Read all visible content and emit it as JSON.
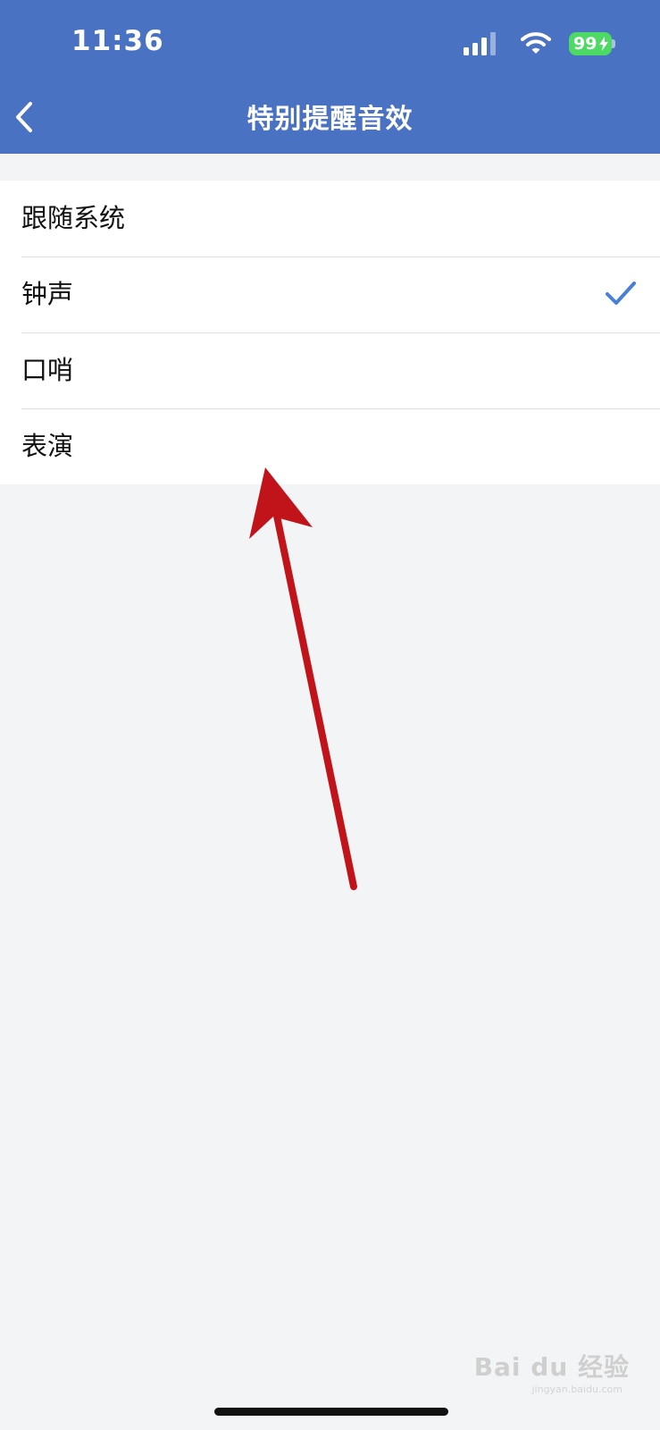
{
  "status_bar": {
    "time": "11:36",
    "battery_level": "99",
    "icons": [
      "signal-icon",
      "wifi-icon",
      "battery-charging-icon"
    ]
  },
  "header": {
    "title": "特别提醒音效",
    "back_icon": "chevron-left-icon",
    "background_color": "#4a72c2"
  },
  "options": [
    {
      "label": "跟随系统",
      "selected": false
    },
    {
      "label": "钟声",
      "selected": true
    },
    {
      "label": "口哨",
      "selected": false
    },
    {
      "label": "表演",
      "selected": false
    }
  ],
  "colors": {
    "accent": "#4a72c2",
    "check": "#4a7fd6",
    "annotation_arrow": "#c0141a",
    "background": "#f3f4f6"
  },
  "watermark": {
    "brand": "Bai du 经验",
    "url": "jingyan.baidu.com"
  }
}
